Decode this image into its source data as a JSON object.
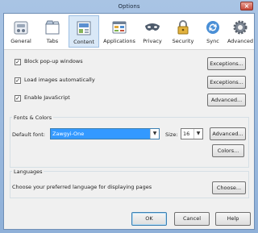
{
  "window": {
    "title": "Options",
    "close_glyph": "×"
  },
  "tabs": [
    {
      "label": "General",
      "icon": "general-switch-icon"
    },
    {
      "label": "Tabs",
      "icon": "tabs-icon"
    },
    {
      "label": "Content",
      "icon": "content-icon",
      "selected": true
    },
    {
      "label": "Applications",
      "icon": "applications-icon"
    },
    {
      "label": "Privacy",
      "icon": "privacy-mask-icon"
    },
    {
      "label": "Security",
      "icon": "security-lock-icon"
    },
    {
      "label": "Sync",
      "icon": "sync-icon"
    },
    {
      "label": "Advanced",
      "icon": "advanced-gear-icon"
    }
  ],
  "content": {
    "popup": {
      "label": "Block pop-up windows",
      "checked": true,
      "button": "Exceptions..."
    },
    "images": {
      "label": "Load images automatically",
      "checked": true,
      "button": "Exceptions..."
    },
    "javascript": {
      "label": "Enable JavaScript",
      "checked": true,
      "button": "Advanced..."
    }
  },
  "fonts": {
    "section_title": "Fonts & Colors",
    "default_font_label": "Default font:",
    "default_font_value": "Zawgyi-One",
    "size_label": "Size:",
    "size_value": "16",
    "advanced_button": "Advanced...",
    "colors_button": "Colors..."
  },
  "languages": {
    "section_title": "Languages",
    "description": "Choose your preferred language for displaying pages",
    "choose_button": "Choose..."
  },
  "footer": {
    "ok": "OK",
    "cancel": "Cancel",
    "help": "Help"
  },
  "colors": {
    "accent": "#3399ff",
    "tab_selected": "#d9e8f7",
    "window_frame": "#a9c4e4"
  }
}
